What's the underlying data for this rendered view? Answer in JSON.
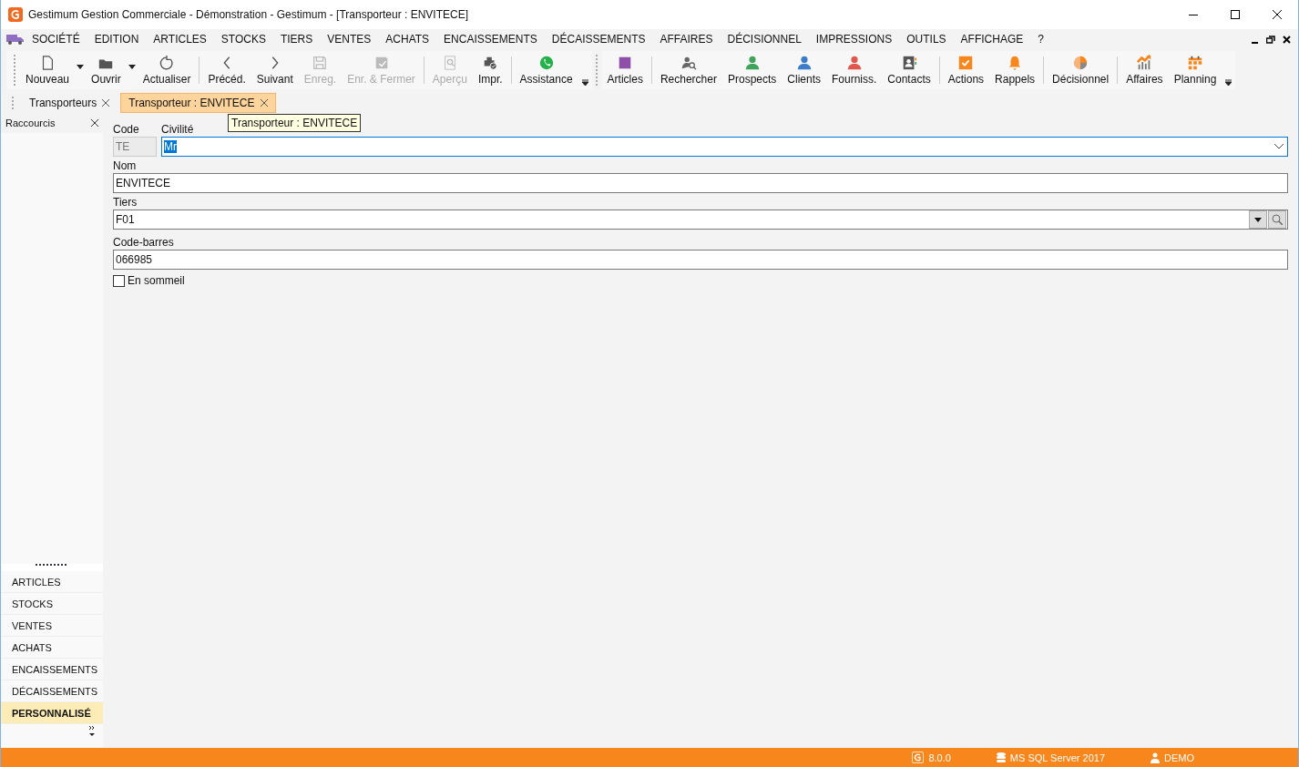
{
  "window": {
    "title": "Gestimum Gestion Commerciale - Démonstration - Gestimum - [Transporteur : ENVITECE]"
  },
  "menu": [
    "SOCIÉTÉ",
    "EDITION",
    "ARTICLES",
    "STOCKS",
    "TIERS",
    "VENTES",
    "ACHATS",
    "ENCAISSEMENTS",
    "DÉCAISSEMENTS",
    "AFFAIRES",
    "DÉCISIONNEL",
    "IMPRESSIONS",
    "OUTILS",
    "AFFICHAGE",
    "?"
  ],
  "toolbar": [
    {
      "label": "Nouveau",
      "disabled": false,
      "dropdown": true
    },
    {
      "label": "Ouvrir",
      "disabled": false,
      "dropdown": true
    },
    {
      "label": "Actualiser",
      "disabled": false,
      "dropdown": false
    },
    {
      "label": "Précéd.",
      "disabled": false,
      "dropdown": false
    },
    {
      "label": "Suivant",
      "disabled": false,
      "dropdown": false
    },
    {
      "label": "Enreg.",
      "disabled": true,
      "dropdown": false
    },
    {
      "label": "Enr. & Fermer",
      "disabled": true,
      "dropdown": false
    },
    {
      "label": "Aperçu",
      "disabled": true,
      "dropdown": false
    },
    {
      "label": "Impr.",
      "disabled": false,
      "dropdown": false
    },
    {
      "label": "Assistance",
      "disabled": false,
      "dropdown": false
    }
  ],
  "shortcuts": [
    {
      "label": "Articles",
      "color": "#8e4fa9"
    },
    {
      "label": "Rechercher",
      "color": "#666666"
    },
    {
      "label": "Prospects",
      "color": "#3fa35b"
    },
    {
      "label": "Clients",
      "color": "#3d7cc9"
    },
    {
      "label": "Fourniss.",
      "color": "#e2574c"
    },
    {
      "label": "Contacts",
      "color": "#555555"
    },
    {
      "label": "Actions",
      "color": "#f7861c"
    },
    {
      "label": "Rappels",
      "color": "#f7861c"
    },
    {
      "label": "Décisionnel",
      "color": "#f7861c"
    },
    {
      "label": "Affaires",
      "color": "#f7861c"
    },
    {
      "label": "Planning",
      "color": "#f7861c"
    }
  ],
  "tabs": [
    {
      "label": "Transporteurs",
      "selected": false
    },
    {
      "label": "Transporteur : ENVITECE",
      "selected": true
    }
  ],
  "tooltip": "Transporteur : ENVITECE",
  "sidebar": {
    "title": "Raccourcis",
    "items": [
      {
        "label": "ARTICLES",
        "selected": false
      },
      {
        "label": "STOCKS",
        "selected": false
      },
      {
        "label": "VENTES",
        "selected": false
      },
      {
        "label": "ACHATS",
        "selected": false
      },
      {
        "label": "ENCAISSEMENTS",
        "selected": false
      },
      {
        "label": "DÉCAISSEMENTS",
        "selected": false
      },
      {
        "label": "PERSONNALISÉ",
        "selected": true
      }
    ]
  },
  "form": {
    "code": {
      "label": "Code",
      "value": "TE",
      "disabled": true
    },
    "civilite": {
      "label": "Civilité",
      "value": "Mr"
    },
    "nom": {
      "label": "Nom",
      "value": "ENVITECE"
    },
    "tiers": {
      "label": "Tiers",
      "value": "F01"
    },
    "code_barres": {
      "label": "Code-barres",
      "value": "066985"
    },
    "sommeil": {
      "label": "En sommeil",
      "checked": false
    }
  },
  "status_bar": {
    "version": "8.0.0",
    "database": "MS SQL Server 2017",
    "user": "DEMO"
  }
}
